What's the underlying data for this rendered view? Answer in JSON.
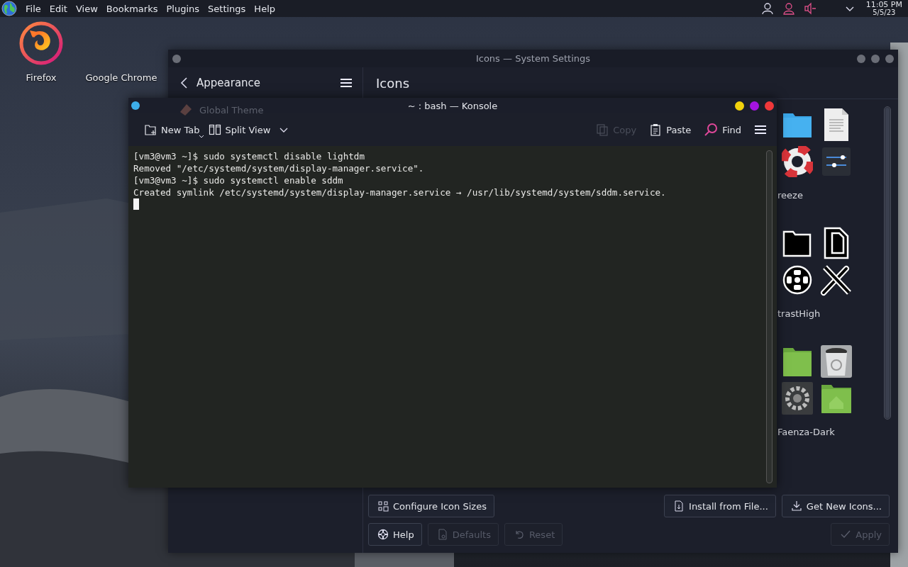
{
  "panel": {
    "menus": [
      "File",
      "Edit",
      "View",
      "Bookmarks",
      "Plugins",
      "Settings",
      "Help"
    ],
    "clock": {
      "time": "11:05 PM",
      "date": "5/5/23"
    }
  },
  "desktop_icons": [
    {
      "label": "Firefox",
      "kind": "firefox"
    },
    {
      "label": "Google Chrome",
      "kind": "blank"
    }
  ],
  "settings_window": {
    "title": "Icons — System Settings",
    "sidebar": {
      "header": "Appearance",
      "items": [
        {
          "label": "Global Theme"
        }
      ]
    },
    "page_title": "Icons",
    "themes": [
      {
        "name": "reeze",
        "kind": "flat"
      },
      {
        "name": "trastHigh",
        "kind": "outline"
      },
      {
        "name": "Faenza-Dark",
        "kind": "glossy"
      }
    ],
    "button_rows": [
      {
        "left": [
          {
            "label": "Configure Icon Sizes",
            "kind": "sizes",
            "disabled": false
          }
        ],
        "right": [
          {
            "label": "Install from File...",
            "kind": "install",
            "disabled": false
          },
          {
            "label": "Get New Icons...",
            "kind": "download",
            "disabled": false
          }
        ]
      },
      {
        "left": [
          {
            "label": "Help",
            "kind": "help",
            "disabled": false
          },
          {
            "label": "Defaults",
            "kind": "defaults",
            "disabled": true
          },
          {
            "label": "Reset",
            "kind": "reset",
            "disabled": true
          }
        ],
        "right": [
          {
            "label": "Apply",
            "kind": "apply",
            "disabled": true
          }
        ]
      }
    ]
  },
  "konsole": {
    "title": "~ : bash — Konsole",
    "toolbar_left": [
      {
        "label": "New Tab",
        "kind": "newtab",
        "disabled": false
      },
      {
        "label": "Split View",
        "kind": "split",
        "disabled": false
      }
    ],
    "toolbar_right": [
      {
        "label": "Copy",
        "kind": "copy",
        "disabled": true
      },
      {
        "label": "Paste",
        "kind": "paste",
        "disabled": false
      },
      {
        "label": "Find",
        "kind": "find",
        "disabled": false
      }
    ],
    "lines": [
      "[vm3@vm3 ~]$ sudo systemctl disable lightdm",
      "Removed \"/etc/systemd/system/display-manager.service\".",
      "[vm3@vm3 ~]$ sudo systemctl enable sddm",
      "Created symlink /etc/systemd/system/display-manager.service → /usr/lib/systemd/system/sddm.service."
    ]
  }
}
